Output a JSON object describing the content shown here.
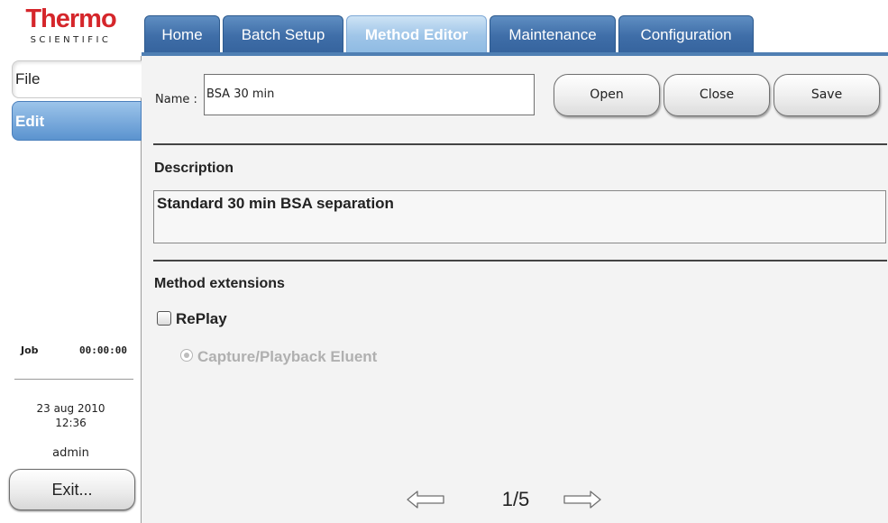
{
  "logo": {
    "word": "Thermo",
    "sub": "SCIENTIFIC"
  },
  "tabs": [
    {
      "label": "Home"
    },
    {
      "label": "Batch Setup"
    },
    {
      "label": "Method Editor",
      "active": true
    },
    {
      "label": "Maintenance"
    },
    {
      "label": "Configuration"
    }
  ],
  "sidebar": {
    "file_label": "File",
    "edit_label": "Edit",
    "job_label": "Job",
    "job_time": "00:00:00",
    "date": "23 aug 2010",
    "time": "12:36",
    "user": "admin",
    "exit_label": "Exit..."
  },
  "method": {
    "name_label": "Name :",
    "name_value": "BSA 30 min",
    "open_label": "Open",
    "close_label": "Close",
    "save_label": "Save",
    "description_heading": "Description",
    "description_value": "Standard 30 min BSA separation",
    "extensions_heading": "Method extensions",
    "replay_label": "RePlay",
    "replay_checked": false,
    "capture_label": "Capture/Playback Eluent",
    "capture_enabled": false
  },
  "pager": {
    "page": "1/5"
  },
  "icons": {
    "prev": "left-arrow-icon",
    "next": "right-arrow-icon"
  },
  "colors": {
    "tab_blue": "#3f6ea8",
    "tab_active": "#9fc5e8",
    "brand_red": "#d5262b",
    "edit_blue": "#5b93cf"
  }
}
